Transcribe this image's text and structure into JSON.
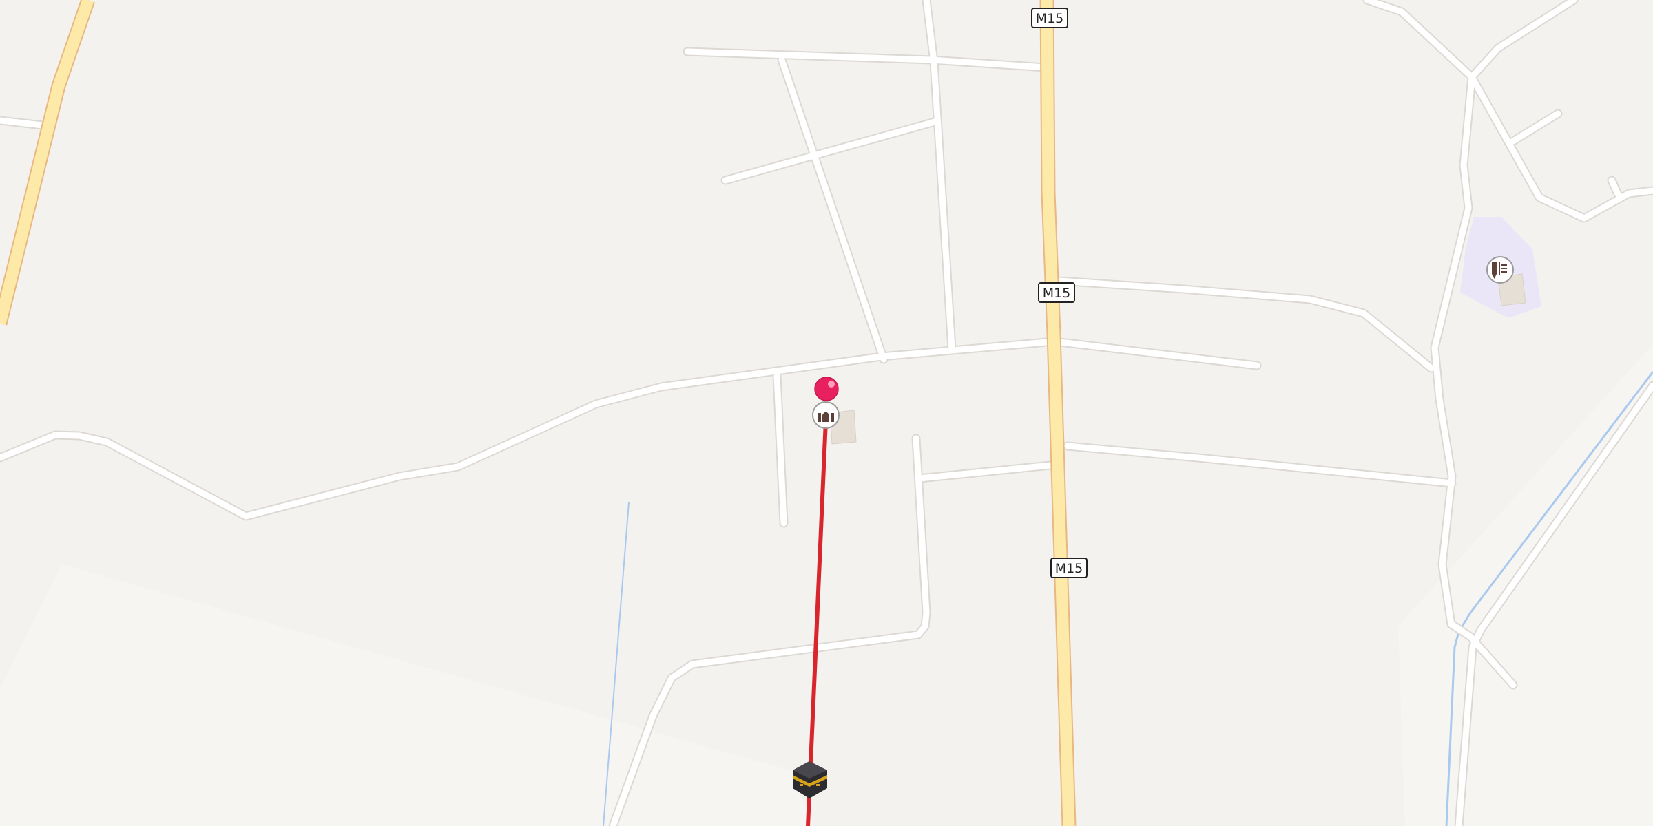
{
  "map": {
    "road_labels": {
      "m15_top": "M15",
      "m15_middle": "M15",
      "m15_bottom": "M15"
    },
    "markers": {
      "user_location": "red-pin-icon",
      "kaaba": "kaaba-icon",
      "mosque": "mosque-icon",
      "school": "school-icon"
    },
    "colors": {
      "background": "#f4f2ef",
      "road": "#ffffff",
      "road_casing": "#dcd8d3",
      "primary_road": "#fde9a8",
      "primary_road_casing": "#e9b882",
      "qibla_line": "#d9252c",
      "pin": "#e9205f",
      "water": "#a9c9ee",
      "school_area": "#ebe6f7"
    }
  }
}
